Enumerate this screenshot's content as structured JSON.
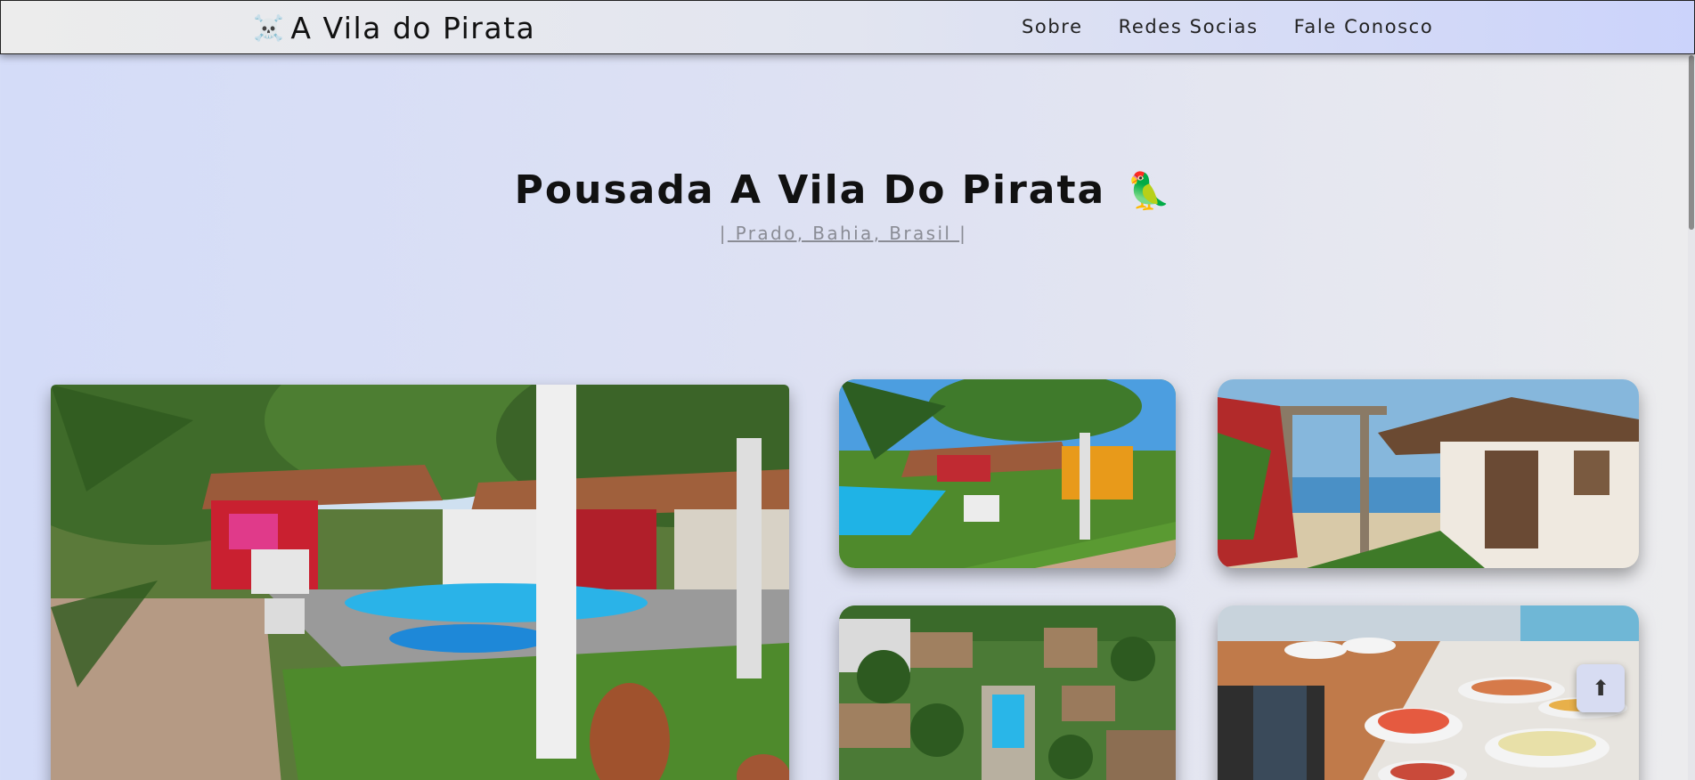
{
  "navbar": {
    "brand_icon": "☠️",
    "brand": "A Vila do Pirata",
    "links": [
      "Sobre",
      "Redes Socias",
      "Fale Conosco"
    ]
  },
  "hero": {
    "title": "Pousada A Vila Do Pirata",
    "title_emoji": "🦜",
    "subtitle_open": "|",
    "subtitle_link": " Prado, Bahia, Brasil ",
    "subtitle_close": "|"
  },
  "scroll_top": {
    "icon": "arrow-up-icon",
    "glyph": "⬆"
  }
}
